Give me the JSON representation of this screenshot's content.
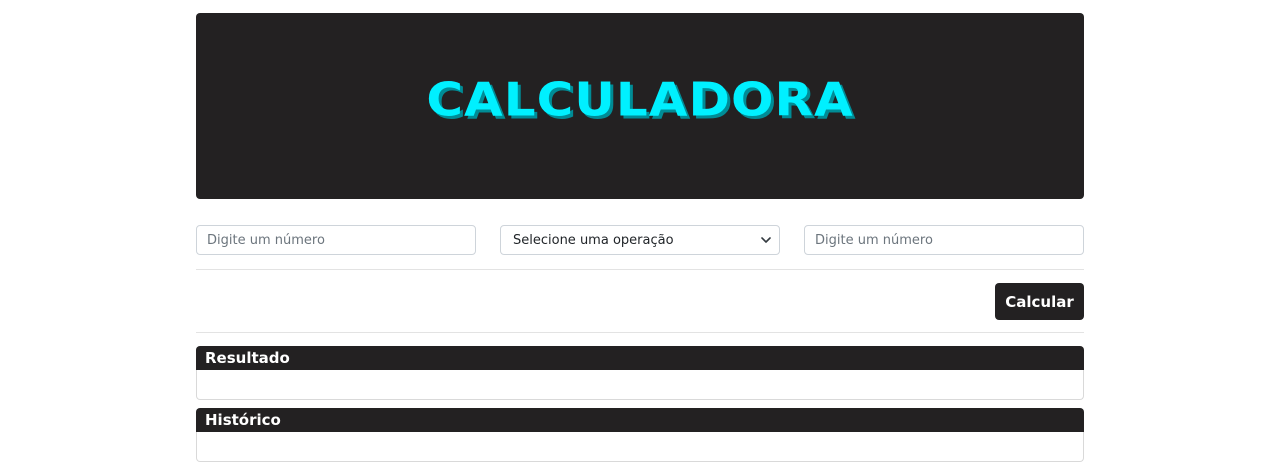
{
  "header": {
    "title": "CALCULADORA"
  },
  "form": {
    "first_number_placeholder": "Digite um número",
    "operation_selected": "Selecione uma operação",
    "second_number_placeholder": "Digite um número",
    "calculate_label": "Calcular"
  },
  "result": {
    "title": "Resultado",
    "value": ""
  },
  "history": {
    "title": "Histórico",
    "entries": []
  },
  "colors": {
    "banner_bg": "#232122",
    "title_color": "#00f0ff",
    "button_bg": "#232122"
  }
}
